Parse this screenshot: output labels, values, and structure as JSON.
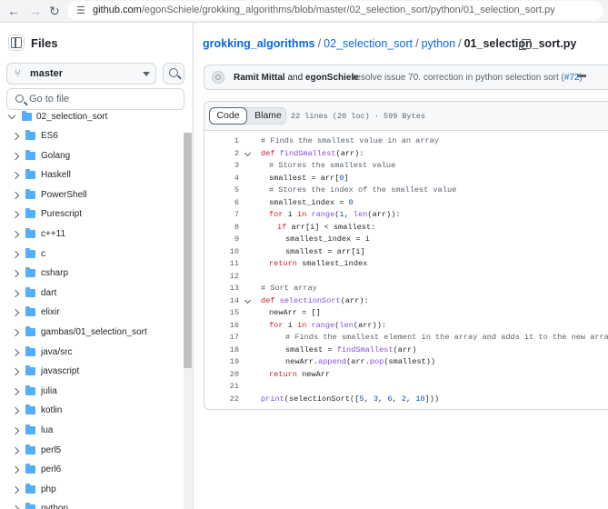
{
  "browser": {
    "url_domain": "github.com",
    "url_path": "/egonSchiele/grokking_algorithms/blob/master/02_selection_sort/python/01_selection_sort.py"
  },
  "sidebar": {
    "title": "Files",
    "branch": "master",
    "goto_placeholder": "Go to file",
    "open_folder": "02_selection_sort",
    "folders": [
      "ES6",
      "Golang",
      "Haskell",
      "PowerShell",
      "Purescript",
      "c++11",
      "c",
      "csharp",
      "dart",
      "elixir",
      "gambas/01_selection_sort",
      "java/src",
      "javascript",
      "julia",
      "kotlin",
      "lua",
      "perl5",
      "perl6",
      "php",
      "python"
    ]
  },
  "breadcrumb": {
    "repo": "grokking_algorithms",
    "folder1": "02_selection_sort",
    "folder2": "python",
    "file": "01_selection_sort.py"
  },
  "commit": {
    "author1": "Ramit Mittal",
    "and": "and",
    "author2": "egonSchiele",
    "message": "resolve issue 70. correction in python selection sort (",
    "pr": "#72",
    "close": ")"
  },
  "file_view": {
    "code_tab": "Code",
    "blame_tab": "Blame",
    "info": "22 lines (20 loc) · 599 Bytes"
  },
  "code_lines": [
    {
      "n": "1",
      "fold": false,
      "indent": 0,
      "tokens": [
        [
          "cm",
          "# Finds the smallest value in an array"
        ]
      ]
    },
    {
      "n": "2",
      "fold": true,
      "indent": 0,
      "tokens": [
        [
          "kw",
          "def "
        ],
        [
          "fn",
          "findSmallest"
        ],
        [
          "",
          "(arr):"
        ]
      ]
    },
    {
      "n": "3",
      "fold": false,
      "indent": 1,
      "tokens": [
        [
          "cm",
          "# Stores the smallest value"
        ]
      ]
    },
    {
      "n": "4",
      "fold": false,
      "indent": 1,
      "tokens": [
        [
          "",
          "smallest = arr["
        ],
        [
          "num",
          "0"
        ],
        [
          "",
          "]"
        ]
      ]
    },
    {
      "n": "5",
      "fold": false,
      "indent": 1,
      "tokens": [
        [
          "cm",
          "# Stores the index of the smallest value"
        ]
      ]
    },
    {
      "n": "6",
      "fold": false,
      "indent": 1,
      "tokens": [
        [
          "",
          "smallest_index = "
        ],
        [
          "num",
          "0"
        ]
      ]
    },
    {
      "n": "7",
      "fold": false,
      "indent": 1,
      "tokens": [
        [
          "kw",
          "for "
        ],
        [
          "",
          "i "
        ],
        [
          "kw",
          "in "
        ],
        [
          "bi",
          "range"
        ],
        [
          "",
          "("
        ],
        [
          "num",
          "1"
        ],
        [
          "",
          ", "
        ],
        [
          "bi",
          "len"
        ],
        [
          "",
          "(arr)):"
        ]
      ]
    },
    {
      "n": "8",
      "fold": false,
      "indent": 2,
      "tokens": [
        [
          "kw",
          "if "
        ],
        [
          "",
          "arr[i] < smallest:"
        ]
      ]
    },
    {
      "n": "9",
      "fold": false,
      "indent": 3,
      "tokens": [
        [
          "",
          "smallest_index = i"
        ]
      ]
    },
    {
      "n": "10",
      "fold": false,
      "indent": 3,
      "tokens": [
        [
          "",
          "smallest = arr[i]"
        ]
      ]
    },
    {
      "n": "11",
      "fold": false,
      "indent": 1,
      "tokens": [
        [
          "kw",
          "return "
        ],
        [
          "",
          "smallest_index"
        ]
      ]
    },
    {
      "n": "12",
      "fold": false,
      "indent": 0,
      "tokens": []
    },
    {
      "n": "13",
      "fold": false,
      "indent": 0,
      "tokens": [
        [
          "cm",
          "# Sort array"
        ]
      ]
    },
    {
      "n": "14",
      "fold": true,
      "indent": 0,
      "tokens": [
        [
          "kw",
          "def "
        ],
        [
          "fn",
          "selectionSort"
        ],
        [
          "",
          "(arr):"
        ]
      ]
    },
    {
      "n": "15",
      "fold": false,
      "indent": 1,
      "tokens": [
        [
          "",
          "newArr = []"
        ]
      ]
    },
    {
      "n": "16",
      "fold": false,
      "indent": 1,
      "tokens": [
        [
          "kw",
          "for "
        ],
        [
          "",
          "i "
        ],
        [
          "kw",
          "in "
        ],
        [
          "bi",
          "range"
        ],
        [
          "",
          "("
        ],
        [
          "bi",
          "len"
        ],
        [
          "",
          "(arr)):"
        ]
      ]
    },
    {
      "n": "17",
      "fold": false,
      "indent": 3,
      "tokens": [
        [
          "cm",
          "# Finds the smallest element in the array and adds it to the new array"
        ]
      ]
    },
    {
      "n": "18",
      "fold": false,
      "indent": 3,
      "tokens": [
        [
          "",
          "smallest = "
        ],
        [
          "fn",
          "findSmallest"
        ],
        [
          "",
          "(arr)"
        ]
      ]
    },
    {
      "n": "19",
      "fold": false,
      "indent": 3,
      "tokens": [
        [
          "",
          "newArr."
        ],
        [
          "fn",
          "append"
        ],
        [
          "",
          "(arr."
        ],
        [
          "fn",
          "pop"
        ],
        [
          "",
          "(smallest))"
        ]
      ]
    },
    {
      "n": "20",
      "fold": false,
      "indent": 1,
      "tokens": [
        [
          "kw",
          "return "
        ],
        [
          "",
          "newArr"
        ]
      ]
    },
    {
      "n": "21",
      "fold": false,
      "indent": 0,
      "tokens": []
    },
    {
      "n": "22",
      "fold": false,
      "indent": 0,
      "tokens": [
        [
          "bi",
          "print"
        ],
        [
          "",
          "(selectionSort(["
        ],
        [
          "num",
          "5"
        ],
        [
          "",
          ", "
        ],
        [
          "num",
          "3"
        ],
        [
          "",
          ", "
        ],
        [
          "num",
          "6"
        ],
        [
          "",
          ", "
        ],
        [
          "num",
          "2"
        ],
        [
          "",
          ", "
        ],
        [
          "num",
          "10"
        ],
        [
          "",
          "]))"
        ]
      ]
    }
  ]
}
